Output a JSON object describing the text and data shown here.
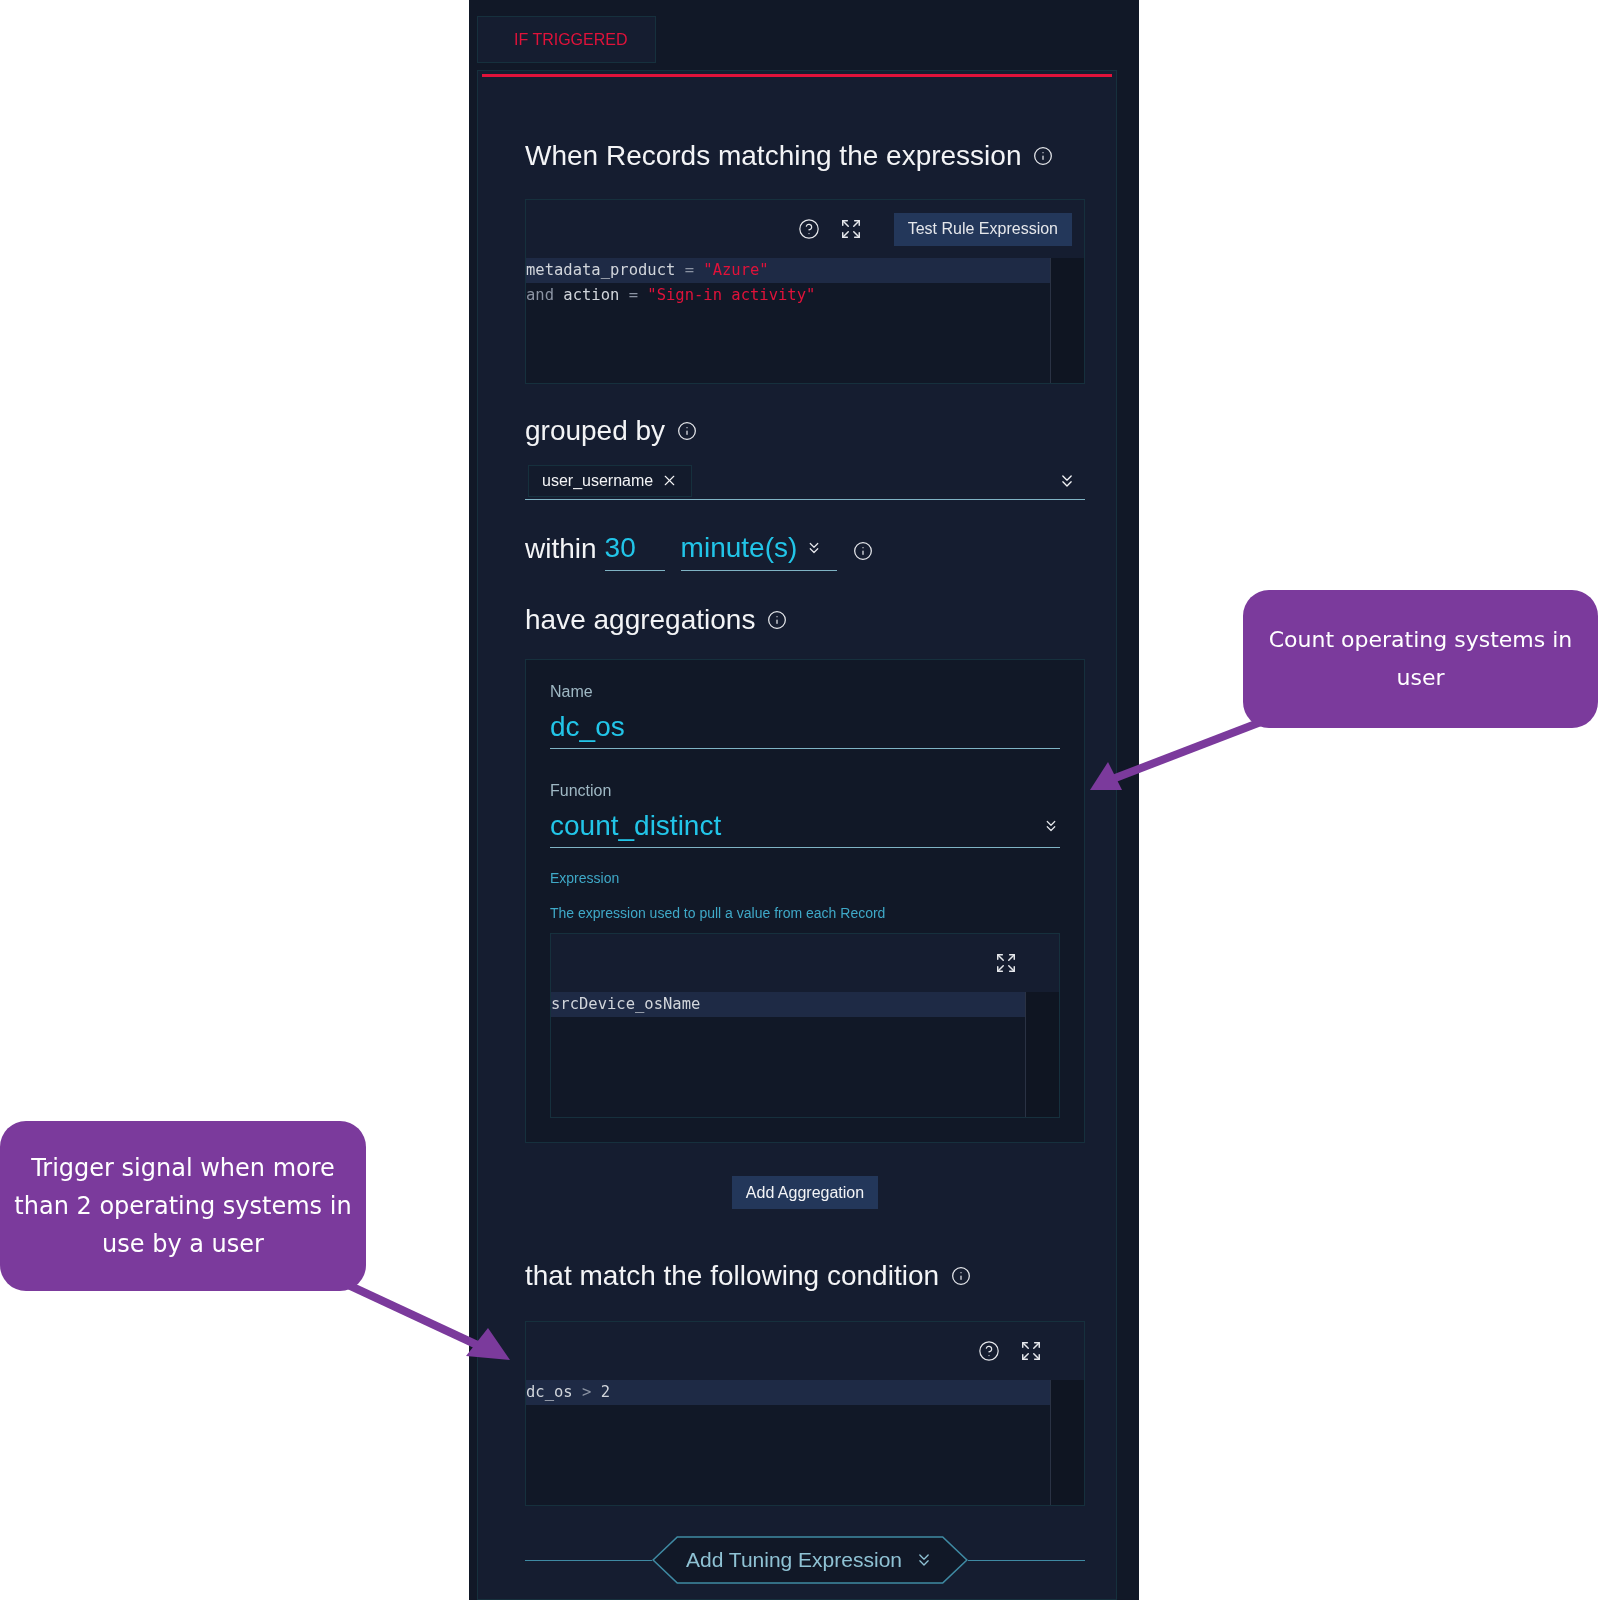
{
  "tab": {
    "label": "IF TRIGGERED",
    "selected": true
  },
  "match_expression": {
    "heading": "When Records matching the expression",
    "test_button": "Test Rule Expression",
    "lines": [
      {
        "active": true,
        "tokens": [
          {
            "text": "metadata_product",
            "kind": "ident"
          },
          {
            "text": " = ",
            "kind": "operator"
          },
          {
            "text": "\"Azure\"",
            "kind": "string"
          }
        ]
      },
      {
        "active": false,
        "tokens": [
          {
            "text": "and",
            "kind": "keyword"
          },
          {
            "text": " action",
            "kind": "ident"
          },
          {
            "text": " = ",
            "kind": "operator"
          },
          {
            "text": "\"Sign-in activity\"",
            "kind": "string"
          }
        ]
      }
    ]
  },
  "grouped_by": {
    "heading": "grouped by",
    "chips": [
      "user_username"
    ]
  },
  "within": {
    "label": "within",
    "value": "30",
    "unit": "minute(s)"
  },
  "aggregations": {
    "heading": "have aggregations",
    "items": [
      {
        "name_label": "Name",
        "name": "dc_os",
        "function_label": "Function",
        "function": "count_distinct",
        "expression_label": "Expression",
        "expression_help": "The expression used to pull a value from each Record",
        "lines": [
          {
            "active": true,
            "tokens": [
              {
                "text": "srcDevice_osName",
                "kind": "ident"
              }
            ]
          }
        ]
      }
    ],
    "add_button": "Add Aggregation"
  },
  "condition": {
    "heading": "that match the following condition",
    "lines": [
      {
        "active": true,
        "tokens": [
          {
            "text": "dc_os",
            "kind": "ident"
          },
          {
            "text": " > ",
            "kind": "operator"
          },
          {
            "text": "2",
            "kind": "number"
          }
        ]
      }
    ]
  },
  "tuning": {
    "label": "Add Tuning Expression"
  },
  "callouts": [
    {
      "text": "Count operating systems in user"
    },
    {
      "text": "Trigger signal when more than 2 operating systems in use by a user"
    }
  ]
}
